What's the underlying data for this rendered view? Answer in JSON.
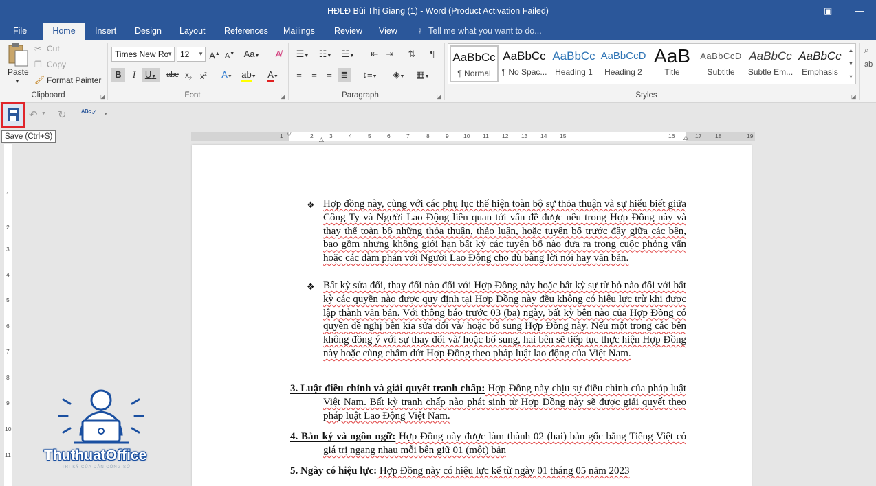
{
  "window": {
    "title": "HĐLĐ Bùi Thị Giang (1) - Word (Product Activation Failed)",
    "restore_icon": "ribbon-display-options-icon",
    "minimize": "—"
  },
  "tabs": [
    {
      "label": "File"
    },
    {
      "label": "Home",
      "active": true
    },
    {
      "label": "Insert"
    },
    {
      "label": "Design"
    },
    {
      "label": "Layout"
    },
    {
      "label": "References"
    },
    {
      "label": "Mailings"
    },
    {
      "label": "Review"
    },
    {
      "label": "View"
    }
  ],
  "tellme": {
    "label": "Tell me what you want to do..."
  },
  "clipboard": {
    "paste": "Paste",
    "cut": "Cut",
    "copy": "Copy",
    "format_painter": "Format Painter",
    "group_label": "Clipboard"
  },
  "font": {
    "name": "Times New Ro",
    "size": "12",
    "group_label": "Font",
    "case_label": "Aa"
  },
  "paragraph": {
    "group_label": "Paragraph"
  },
  "styles": {
    "group_label": "Styles",
    "items": [
      {
        "preview": "AaBbCc",
        "name": "¶ Normal",
        "color": "#111111",
        "selected": true
      },
      {
        "preview": "AaBbCc",
        "name": "¶ No Spac...",
        "color": "#111111"
      },
      {
        "preview": "AaBbCc",
        "name": "Heading 1",
        "color": "#2e74b5"
      },
      {
        "preview": "AaBbCcD",
        "name": "Heading 2",
        "color": "#2e74b5"
      },
      {
        "preview": "AaB",
        "name": "Title",
        "color": "#111111"
      },
      {
        "preview": "AaBbCcD",
        "name": "Subtitle",
        "color": "#595959"
      },
      {
        "preview": "AaBbCc",
        "name": "Subtle Em...",
        "color": "#404040"
      },
      {
        "preview": "AaBbCc",
        "name": "Emphasis",
        "color": "#404040"
      }
    ]
  },
  "qat": {
    "tooltip": "Save (Ctrl+S)"
  },
  "ruler": {
    "h_numbers": [
      "1",
      "1",
      "2",
      "3",
      "4",
      "5",
      "6",
      "7",
      "8",
      "9",
      "10",
      "11",
      "12",
      "13",
      "14",
      "15",
      "16",
      "17",
      "18",
      "19"
    ],
    "v_numbers": [
      "1",
      "2",
      "3",
      "4",
      "5",
      "6",
      "7",
      "8",
      "9",
      "10",
      "11"
    ]
  },
  "document": {
    "bullet1": "Hợp đồng này, cùng với các phụ lục thể hiện toàn bộ sự thỏa thuận và sự hiểu biết giữa Công Ty và Người Lao Động liên quan tới vấn đề được nêu trong Hợp Đồng này và thay thế toàn bộ những thỏa thuận, thảo luận, hoặc tuyên bố trước đây giữa các bên, bao gồm nhưng không giới hạn bất kỳ các tuyên bố nào đưa ra trong cuộc phỏng vấn hoặc các đàm phán với Người Lao Động cho dù bằng lời nói hay văn bản.",
    "bullet2": "Bất kỳ sửa đổi, thay đổi nào đối với Hợp Đồng này hoặc bất kỳ sự từ bỏ nào đối với bất kỳ các quyền nào được quy định tại Hợp Đồng này đều không có hiệu lực trừ khi được lập thành văn bản. Với thông báo trước 03 (ba) ngày, bất kỳ bên nào của Hợp Đồng có quyền đề nghị bên kia sửa đổi và/ hoặc bổ sung Hợp Đồng này. Nếu một trong các bên không đồng ý với sự thay đổi và/ hoặc bổ sung, hai bên sẽ tiếp tục thực hiện Hợp Đồng này hoặc cùng chấm dứt Hợp Đồng theo pháp luật lao động của Việt Nam.",
    "s3_head": "3. Luật điều chỉnh và giải quyết tranh chấp:",
    "s3_body": " Hợp Đồng này chịu sự điều chỉnh của pháp luật Việt Nam. Bất kỳ tranh chấp nào phát sinh từ Hợp Đồng này sẽ được giải quyết theo pháp luật Lao Động Việt Nam.",
    "s4_head": "4. Bản ký và ngôn ngữ:",
    "s4_body": " Hợp Đồng này được làm thành 02 (hai) bản gốc bằng Tiếng Việt có giá trị ngang nhau mỗi bên giữ 01 (một) bản",
    "s5_head": "5. Ngày có hiệu lực:",
    "s5_body": " Hợp Đồng này có hiệu lực kể từ ngày 01 tháng 05 năm 2023"
  },
  "watermark": {
    "brand": "ThuthuatOffice",
    "tagline": "TRI KỲ CỦA DÂN CÔNG SỞ"
  }
}
